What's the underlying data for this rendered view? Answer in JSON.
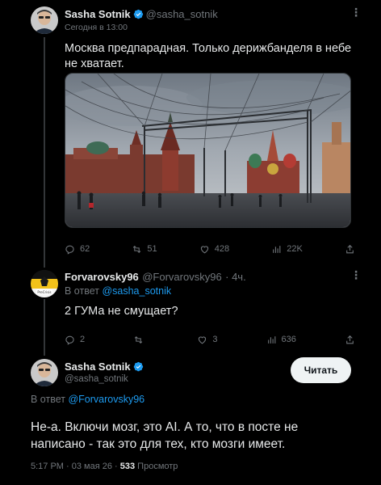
{
  "tweet1": {
    "name": "Sasha Sotnik",
    "handle": "@sasha_sotnik",
    "time": "Сегодня в 13:00",
    "text": "Москва предпарадная. Только дерижбанделя в небе не хватает.",
    "stats": {
      "replies": "62",
      "retweets": "51",
      "likes": "428",
      "views": "22K"
    }
  },
  "tweet2": {
    "name": "Forvarovsky96",
    "handle": "@Forvarovsky96",
    "time": "· 4ч.",
    "reply_label": "В ответ",
    "reply_handle": "@sasha_sotnik",
    "text": "2 ГУМа не смущает?",
    "stats": {
      "replies": "2",
      "retweets": "",
      "likes": "3",
      "views": "636"
    }
  },
  "tweet3": {
    "name": "Sasha Sotnik",
    "handle": "@sasha_sotnik",
    "follow_label": "Читать",
    "reply_label": "В ответ",
    "reply_handle": "@Forvarovsky96",
    "text": "Не-а. Включи мозг, это AI. А то, что в посте не написано - так это для тех, кто мозги имеет.",
    "time": "5:17 PM · 03 мая 26 ·",
    "views_count": "533",
    "views_label": "Просмотр"
  },
  "icons": {
    "reply": "reply-icon",
    "retweet": "retweet-icon",
    "like": "heart-icon",
    "views": "views-icon",
    "share": "share-icon",
    "verified": "verified-badge-icon",
    "more": "more-options-icon"
  },
  "colors": {
    "background": "#000000",
    "text": "#e7e9ea",
    "muted": "#71767b",
    "link": "#1d9bf0",
    "button_bg": "#eff3f4"
  }
}
